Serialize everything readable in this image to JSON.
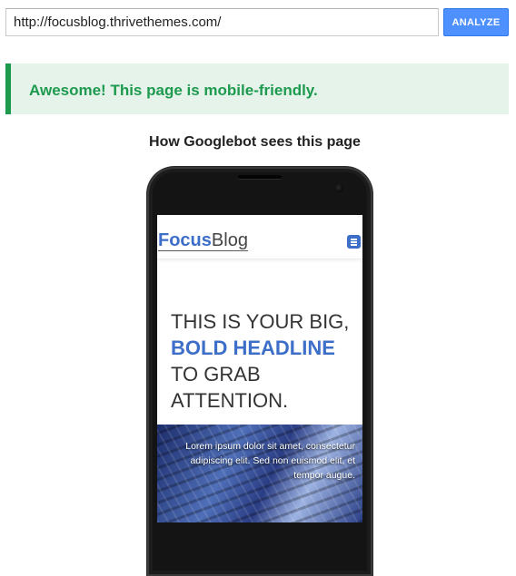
{
  "url_bar": {
    "value": "http://focusblog.thrivethemes.com/",
    "button_label": "ANALYZE"
  },
  "result": {
    "message": "Awesome! This page is mobile-friendly.",
    "color": "#1e9a4f",
    "background": "#e5f3ea"
  },
  "preview": {
    "title": "How Googlebot sees this page"
  },
  "site": {
    "logo_part1": "Focus",
    "logo_part2": "Blog",
    "menu_icon": "hamburger-menu-icon",
    "headline_line1": "THIS IS YOUR BIG,",
    "headline_line2": "BOLD HEADLINE",
    "headline_line3": "TO GRAB",
    "headline_line4": "ATTENTION.",
    "hero_text": "Lorem ipsum dolor sit amet, consectetur adipiscing elit. Sed non euismod elit, et tempor augue.",
    "accent_color": "#3d6fc9"
  }
}
